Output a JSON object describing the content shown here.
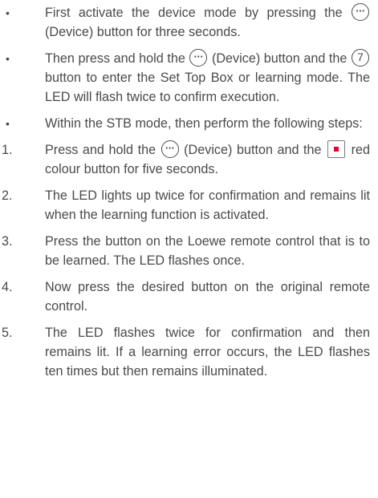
{
  "instructions": {
    "bullets": [
      {
        "marker": "•",
        "before": "First activate the device mode by pressing the ",
        "after": " (Device) button for three seconds."
      },
      {
        "marker": "•",
        "part1": "Then press and hold the ",
        "part2": " (Device) button and the ",
        "part3": " button to enter the Set Top Box or learning mode. The LED will flash twice to confirm execution."
      },
      {
        "marker": "•",
        "text": "Within the STB mode, then perform the following steps:"
      }
    ],
    "steps": [
      {
        "number": "1.",
        "part1": "Press and hold the ",
        "part2": " (Device) button and the ",
        "part3": " red colour button for five seconds."
      },
      {
        "number": "2.",
        "text": "The LED lights up twice for confirmation and remains lit when the learning function is activated."
      },
      {
        "number": "3.",
        "text": "Press the button on the Loewe remote control that is to be learned. The LED flashes once."
      },
      {
        "number": "4.",
        "text": "Now press the desired button on the original remote control."
      },
      {
        "number": "5.",
        "text": "The LED flashes twice for confirmation and then remains lit. If a learning error occurs, the LED flashes ten times but then remains illuminated."
      }
    ]
  },
  "icons": {
    "device_button": "···",
    "seven_button": "7",
    "red_button_color": "#e3002b"
  }
}
